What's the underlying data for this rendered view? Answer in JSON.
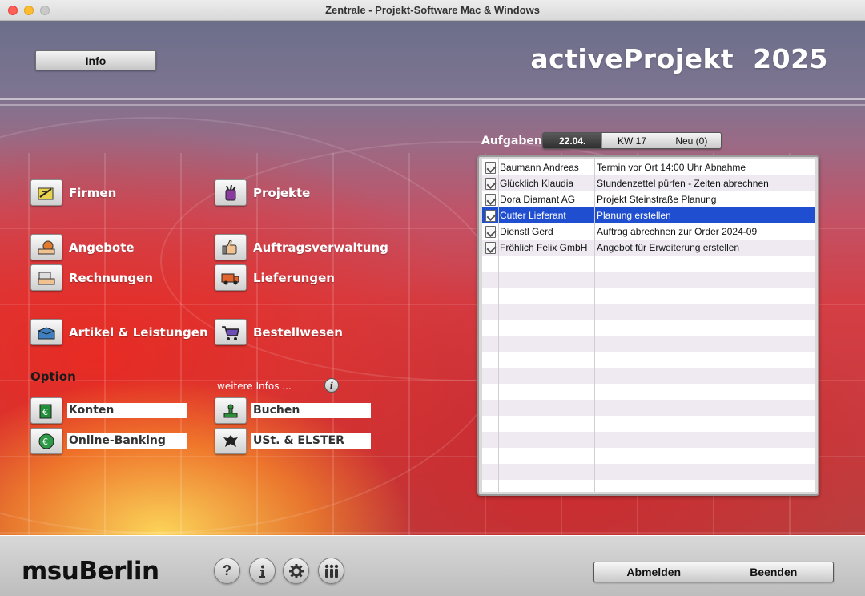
{
  "window": {
    "title": "Zentrale - Projekt-Software Mac & Windows"
  },
  "header": {
    "info_label": "Info",
    "brand": "activeProjekt  2025"
  },
  "modules": {
    "firmen": "Firmen",
    "projekte": "Projekte",
    "angebote": "Angebote",
    "auftragsverwaltung": "Auftragsverwaltung",
    "rechnungen": "Rechnungen",
    "lieferungen": "Lieferungen",
    "artikel": "Artikel & Leistungen",
    "bestellwesen": "Bestellwesen"
  },
  "options": {
    "heading": "Option",
    "more_label": "weitere Infos ...",
    "konten": "Konten",
    "online_banking": "Online-Banking",
    "buchen": "Buchen",
    "ust_elster": "USt. & ELSTER"
  },
  "tasks": {
    "heading": "Aufgaben",
    "tabs": [
      {
        "label": "22.04.",
        "active": true
      },
      {
        "label": "KW 17",
        "active": false
      },
      {
        "label": "Neu (0)",
        "active": false
      }
    ],
    "rows": [
      {
        "name": "Baumann Andreas",
        "task": "Termin vor Ort 14:00 Uhr Abnahme",
        "selected": false
      },
      {
        "name": "Glücklich Klaudia",
        "task": "Stundenzettel pürfen - Zeiten abrechnen",
        "selected": false
      },
      {
        "name": "Dora Diamant AG",
        "task": "Projekt Steinstraße Planung",
        "selected": false
      },
      {
        "name": "Cutter Lieferant",
        "task": "Planung erstellen",
        "selected": true
      },
      {
        "name": "Dienstl Gerd",
        "task": "Auftrag abrechnen zur Order 2024-09",
        "selected": false
      },
      {
        "name": "Fröhlich Felix GmbH",
        "task": "Angebot für Erweiterung erstellen",
        "selected": false
      }
    ],
    "empty_rows": 15
  },
  "footer": {
    "logo": "msuBerlin",
    "icons": [
      "help-icon",
      "info-icon",
      "settings-icon",
      "users-icon"
    ],
    "logout_label": "Abmelden",
    "quit_label": "Beenden"
  },
  "colors": {
    "selection": "#1f4ed0",
    "title_text": "#333333"
  }
}
